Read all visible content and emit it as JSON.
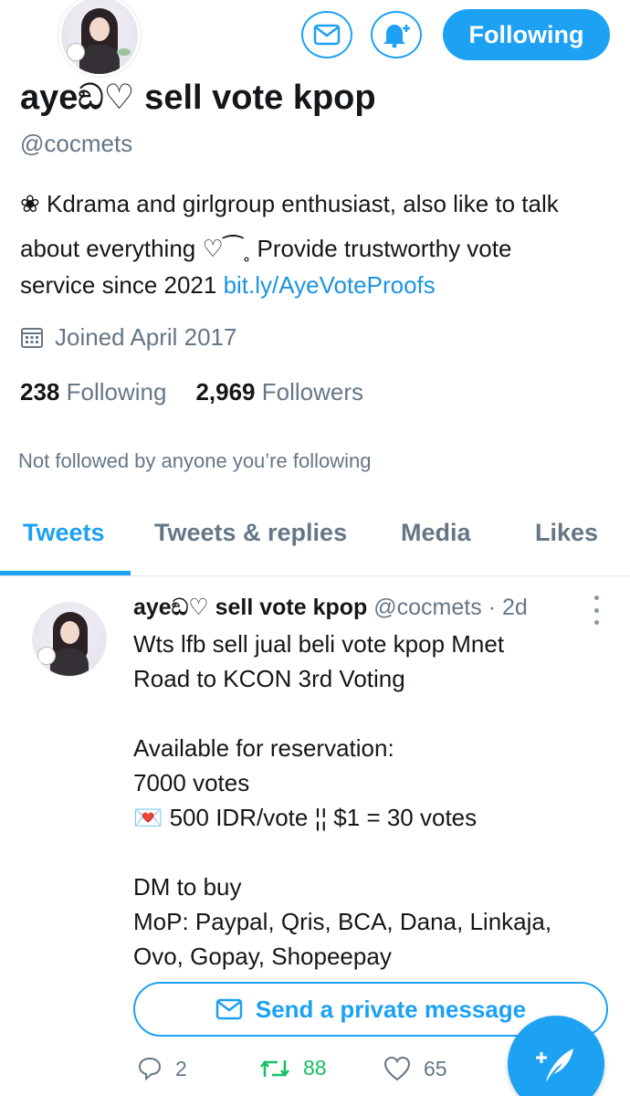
{
  "profile": {
    "display_name": "ayeඞ♡ sell vote kpop",
    "handle": "@cocmets",
    "bio_line1": "❀ Kdrama and girlgroup enthusiast, also like to talk",
    "bio_line2": "about everything ♡⁀˳ Provide trustworthy vote",
    "bio_line3_text": "service since 2021 ",
    "bio_link": "bit.ly/AyeVoteProofs",
    "joined": "Joined April 2017",
    "following_count": "238",
    "following_label": "Following",
    "followers_count": "2,969",
    "followers_label": "Followers",
    "not_followed": "Not followed by anyone you’re following"
  },
  "buttons": {
    "follow_label": "Following",
    "message_icon": "mail-icon",
    "notify_icon": "bell-plus-icon"
  },
  "tabs": [
    {
      "label": "Tweets",
      "active": true
    },
    {
      "label": "Tweets & replies",
      "active": false
    },
    {
      "label": "Media",
      "active": false
    },
    {
      "label": "Likes",
      "active": false
    }
  ],
  "tweet": {
    "author_name": "ayeඞ♡ sell vote kpop",
    "author_handle": "@cocmets",
    "time": "· 2d",
    "lines": [
      "Wts lfb sell jual beli vote kpop Mnet",
      "Road to KCON 3rd Voting",
      "",
      "Available for reservation:",
      "7000 votes",
      "💌 500 IDR/vote ¦¦ $1 = 30 votes",
      "",
      "DM to buy",
      "MoP: Paypal, Qris, BCA, Dana, Linkaja,",
      "Ovo, Gopay, Shopeepay"
    ],
    "dm_button_label": "Send a private message",
    "reply_count": "2",
    "retweet_count": "88",
    "like_count": "65"
  },
  "colors": {
    "accent": "#1da1f2",
    "secondary_text": "#657786",
    "retweet_green": "#17bf63"
  }
}
